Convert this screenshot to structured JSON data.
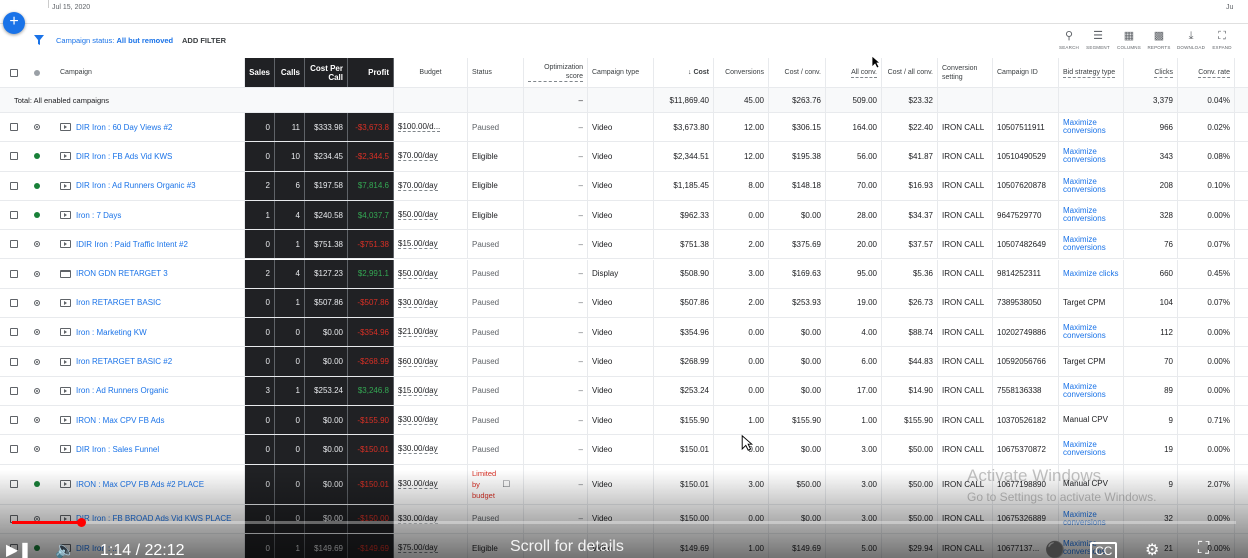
{
  "header": {
    "date_left": "Jul 15, 2020",
    "date_right": "Ju"
  },
  "filter": {
    "prefix": "Campaign status:",
    "value": "All but removed",
    "add_filter": "ADD FILTER"
  },
  "toolbar": [
    {
      "label": "SEARCH",
      "icon": "search-icon"
    },
    {
      "label": "SEGMENT",
      "icon": "segment-icon"
    },
    {
      "label": "COLUMNS",
      "icon": "columns-icon"
    },
    {
      "label": "REPORTS",
      "icon": "reports-icon"
    },
    {
      "label": "DOWNLOAD",
      "icon": "download-icon"
    },
    {
      "label": "EXPAND",
      "icon": "expand-icon"
    }
  ],
  "columns": {
    "campaign": "Campaign",
    "sales": "Sales",
    "calls": "Calls",
    "cost_per_call": "Cost Per Call",
    "profit": "Profit",
    "budget": "Budget",
    "status": "Status",
    "opt_score": "Optimization score",
    "campaign_type": "Campaign type",
    "cost": "↓ Cost",
    "conversions": "Conversions",
    "cost_conv": "Cost / conv.",
    "all_conv": "All conv.",
    "cost_all_conv": "Cost / all conv.",
    "conv_setting": "Conversion setting",
    "campaign_id": "Campaign ID",
    "bid_strategy": "Bid strategy type",
    "clicks": "Clicks",
    "conv_rate": "Conv. rate"
  },
  "total": {
    "label": "Total: All enabled campaigns",
    "opt_score": "–",
    "cost": "$11,869.40",
    "conversions": "45.00",
    "cost_conv": "$263.76",
    "all_conv": "509.00",
    "cost_all_conv": "$23.32",
    "clicks": "3,379",
    "conv_rate": "0.04%"
  },
  "rows": [
    {
      "name": "DIR Iron : 60 Day Views #2",
      "state": "paused",
      "icon": "video",
      "sales": "0",
      "calls": "11",
      "cpc": "$333.98",
      "profit": "-$3,673.8",
      "profit_sign": "neg",
      "budget": "$100.00/d...",
      "status": "Paused",
      "opt": "–",
      "type": "Video",
      "cost": "$3,673.80",
      "conv": "12.00",
      "cost_conv": "$306.15",
      "all_conv": "164.00",
      "cost_all": "$22.40",
      "setting": "IRON CALL",
      "id": "10507511911",
      "bid": "Maximize conversions",
      "bid_link": true,
      "clicks": "966",
      "rate": "0.02%"
    },
    {
      "name": "DIR Iron : FB Ads Vid KWS",
      "state": "eligible",
      "icon": "video",
      "sales": "0",
      "calls": "10",
      "cpc": "$234.45",
      "profit": "-$2,344.5",
      "profit_sign": "neg",
      "budget": "$70.00/day",
      "status": "Eligible",
      "opt": "–",
      "type": "Video",
      "cost": "$2,344.51",
      "conv": "12.00",
      "cost_conv": "$195.38",
      "all_conv": "56.00",
      "cost_all": "$41.87",
      "setting": "IRON CALL",
      "id": "10510490529",
      "bid": "Maximize conversions",
      "bid_link": true,
      "clicks": "343",
      "rate": "0.08%"
    },
    {
      "name": "DIR Iron : Ad Runners Organic #3",
      "state": "eligible",
      "icon": "video",
      "sales": "2",
      "calls": "6",
      "cpc": "$197.58",
      "profit": "$7,814.6",
      "profit_sign": "pos",
      "budget": "$70.00/day",
      "status": "Eligible",
      "opt": "–",
      "type": "Video",
      "cost": "$1,185.45",
      "conv": "8.00",
      "cost_conv": "$148.18",
      "all_conv": "70.00",
      "cost_all": "$16.93",
      "setting": "IRON CALL",
      "id": "10507620878",
      "bid": "Maximize conversions",
      "bid_link": true,
      "clicks": "208",
      "rate": "0.10%"
    },
    {
      "name": "Iron : 7 Days",
      "state": "eligible",
      "icon": "video",
      "sales": "1",
      "calls": "4",
      "cpc": "$240.58",
      "profit": "$4,037.7",
      "profit_sign": "pos",
      "budget": "$50.00/day",
      "status": "Eligible",
      "opt": "–",
      "type": "Video",
      "cost": "$962.33",
      "conv": "0.00",
      "cost_conv": "$0.00",
      "all_conv": "28.00",
      "cost_all": "$34.37",
      "setting": "IRON CALL",
      "id": "9647529770",
      "bid": "Maximize conversions",
      "bid_link": true,
      "clicks": "328",
      "rate": "0.00%"
    },
    {
      "name": "IDIR Iron : Paid Traffic Intent #2",
      "state": "paused",
      "icon": "video",
      "sales": "0",
      "calls": "1",
      "cpc": "$751.38",
      "profit": "-$751.38",
      "profit_sign": "neg",
      "budget": "$15.00/day",
      "status": "Paused",
      "opt": "–",
      "type": "Video",
      "cost": "$751.38",
      "conv": "2.00",
      "cost_conv": "$375.69",
      "all_conv": "20.00",
      "cost_all": "$37.57",
      "setting": "IRON CALL",
      "id": "10507482649",
      "bid": "Maximize conversions",
      "bid_link": true,
      "clicks": "76",
      "rate": "0.07%"
    },
    {
      "name": "IRON GDN RETARGET 3",
      "state": "paused",
      "icon": "display",
      "sales": "2",
      "calls": "4",
      "cpc": "$127.23",
      "profit": "$2,991.1",
      "profit_sign": "pos",
      "budget": "$50.00/day",
      "status": "Paused",
      "opt": "–",
      "type": "Display",
      "cost": "$508.90",
      "conv": "3.00",
      "cost_conv": "$169.63",
      "all_conv": "95.00",
      "cost_all": "$5.36",
      "setting": "IRON CALL",
      "id": "9814252311",
      "bid": "Maximize clicks",
      "bid_link": true,
      "clicks": "660",
      "rate": "0.45%"
    },
    {
      "name": "Iron RETARGET BASIC",
      "state": "paused",
      "icon": "video",
      "sales": "0",
      "calls": "1",
      "cpc": "$507.86",
      "profit": "-$507.86",
      "profit_sign": "neg",
      "budget": "$30.00/day",
      "status": "Paused",
      "opt": "–",
      "type": "Video",
      "cost": "$507.86",
      "conv": "2.00",
      "cost_conv": "$253.93",
      "all_conv": "19.00",
      "cost_all": "$26.73",
      "setting": "IRON CALL",
      "id": "7389538050",
      "bid": "Target CPM",
      "bid_link": false,
      "clicks": "104",
      "rate": "0.07%"
    },
    {
      "name": "Iron : Marketing KW",
      "state": "paused",
      "icon": "video",
      "sales": "0",
      "calls": "0",
      "cpc": "$0.00",
      "profit": "-$354.96",
      "profit_sign": "neg",
      "budget": "$21.00/day",
      "status": "Paused",
      "opt": "–",
      "type": "Video",
      "cost": "$354.96",
      "conv": "0.00",
      "cost_conv": "$0.00",
      "all_conv": "4.00",
      "cost_all": "$88.74",
      "setting": "IRON CALL",
      "id": "10202749886",
      "bid": "Maximize conversions",
      "bid_link": true,
      "clicks": "112",
      "rate": "0.00%"
    },
    {
      "name": "Iron RETARGET BASIC #2",
      "state": "paused",
      "icon": "video",
      "sales": "0",
      "calls": "0",
      "cpc": "$0.00",
      "profit": "-$268.99",
      "profit_sign": "neg",
      "budget": "$60.00/day",
      "status": "Paused",
      "opt": "–",
      "type": "Video",
      "cost": "$268.99",
      "conv": "0.00",
      "cost_conv": "$0.00",
      "all_conv": "6.00",
      "cost_all": "$44.83",
      "setting": "IRON CALL",
      "id": "10592056766",
      "bid": "Target CPM",
      "bid_link": false,
      "clicks": "70",
      "rate": "0.00%"
    },
    {
      "name": "Iron : Ad Runners Organic",
      "state": "paused",
      "icon": "video",
      "sales": "3",
      "calls": "1",
      "cpc": "$253.24",
      "profit": "$3,246.8",
      "profit_sign": "pos",
      "budget": "$15.00/day",
      "status": "Paused",
      "opt": "–",
      "type": "Video",
      "cost": "$253.24",
      "conv": "0.00",
      "cost_conv": "$0.00",
      "all_conv": "17.00",
      "cost_all": "$14.90",
      "setting": "IRON CALL",
      "id": "7558136338",
      "bid": "Maximize conversions",
      "bid_link": true,
      "clicks": "89",
      "rate": "0.00%"
    },
    {
      "name": "IRON : Max CPV FB Ads",
      "state": "paused",
      "icon": "video",
      "sales": "0",
      "calls": "0",
      "cpc": "$0.00",
      "profit": "-$155.90",
      "profit_sign": "neg",
      "budget": "$30.00/day",
      "status": "Paused",
      "opt": "–",
      "type": "Video",
      "cost": "$155.90",
      "conv": "1.00",
      "cost_conv": "$155.90",
      "all_conv": "1.00",
      "cost_all": "$155.90",
      "setting": "IRON CALL",
      "id": "10370526182",
      "bid": "Manual CPV",
      "bid_link": false,
      "clicks": "9",
      "rate": "0.71%"
    },
    {
      "name": "DIR Iron : Sales Funnel",
      "state": "paused",
      "icon": "video",
      "sales": "0",
      "calls": "0",
      "cpc": "$0.00",
      "profit": "-$150.01",
      "profit_sign": "neg",
      "budget": "$30.00/day",
      "status": "Paused",
      "opt": "–",
      "type": "Video",
      "cost": "$150.01",
      "conv": "0.00",
      "cost_conv": "$0.00",
      "all_conv": "3.00",
      "cost_all": "$50.00",
      "setting": "IRON CALL",
      "id": "10675370872",
      "bid": "Maximize conversions",
      "bid_link": true,
      "clicks": "19",
      "rate": "0.00%"
    },
    {
      "name": "IRON : Max CPV FB Ads #2 PLACE",
      "state": "eligible",
      "icon": "video",
      "sales": "0",
      "calls": "0",
      "cpc": "$0.00",
      "profit": "-$150.01",
      "profit_sign": "neg",
      "budget": "$30.00/day",
      "status": "Limited by budget",
      "opt": "–",
      "type": "Video",
      "cost": "$150.01",
      "conv": "3.00",
      "cost_conv": "$50.00",
      "all_conv": "3.00",
      "cost_all": "$50.00",
      "setting": "IRON CALL",
      "id": "10677198890",
      "bid": "Manual CPV",
      "bid_link": false,
      "clicks": "9",
      "rate": "2.07%",
      "tall": true
    },
    {
      "name": "DIR Iron : FB BROAD Ads Vid KWS PLACE",
      "state": "paused",
      "icon": "video",
      "sales": "0",
      "calls": "0",
      "cpc": "$0.00",
      "profit": "-$150.00",
      "profit_sign": "neg",
      "budget": "$30.00/day",
      "status": "Paused",
      "opt": "–",
      "type": "Video",
      "cost": "$150.00",
      "conv": "0.00",
      "cost_conv": "$0.00",
      "all_conv": "3.00",
      "cost_all": "$50.00",
      "setting": "IRON CALL",
      "id": "10675326889",
      "bid": "Maximize conversions",
      "bid_link": true,
      "clicks": "32",
      "rate": "0.00%"
    },
    {
      "name": "DIR Iron : ...",
      "state": "eligible",
      "icon": "video",
      "sales": "0",
      "calls": "1",
      "cpc": "$149.69",
      "profit": "-$149.69",
      "profit_sign": "neg",
      "budget": "$75.00/day",
      "status": "Eligible",
      "opt": "–",
      "type": "Video",
      "cost": "$149.69",
      "conv": "1.00",
      "cost_conv": "$149.69",
      "all_conv": "5.00",
      "cost_all": "$29.94",
      "setting": "IRON CALL",
      "id": "10677137...",
      "bid": "Maximize conversions",
      "bid_link": true,
      "clicks": "21",
      "rate": "0.00%"
    }
  ],
  "player": {
    "time": "1:14 / 22:12",
    "scroll_label": "Scroll for details",
    "progress": 0.056
  },
  "watermark": {
    "line1": "Activate Windows",
    "line2": "Go to Settings to activate Windows."
  }
}
